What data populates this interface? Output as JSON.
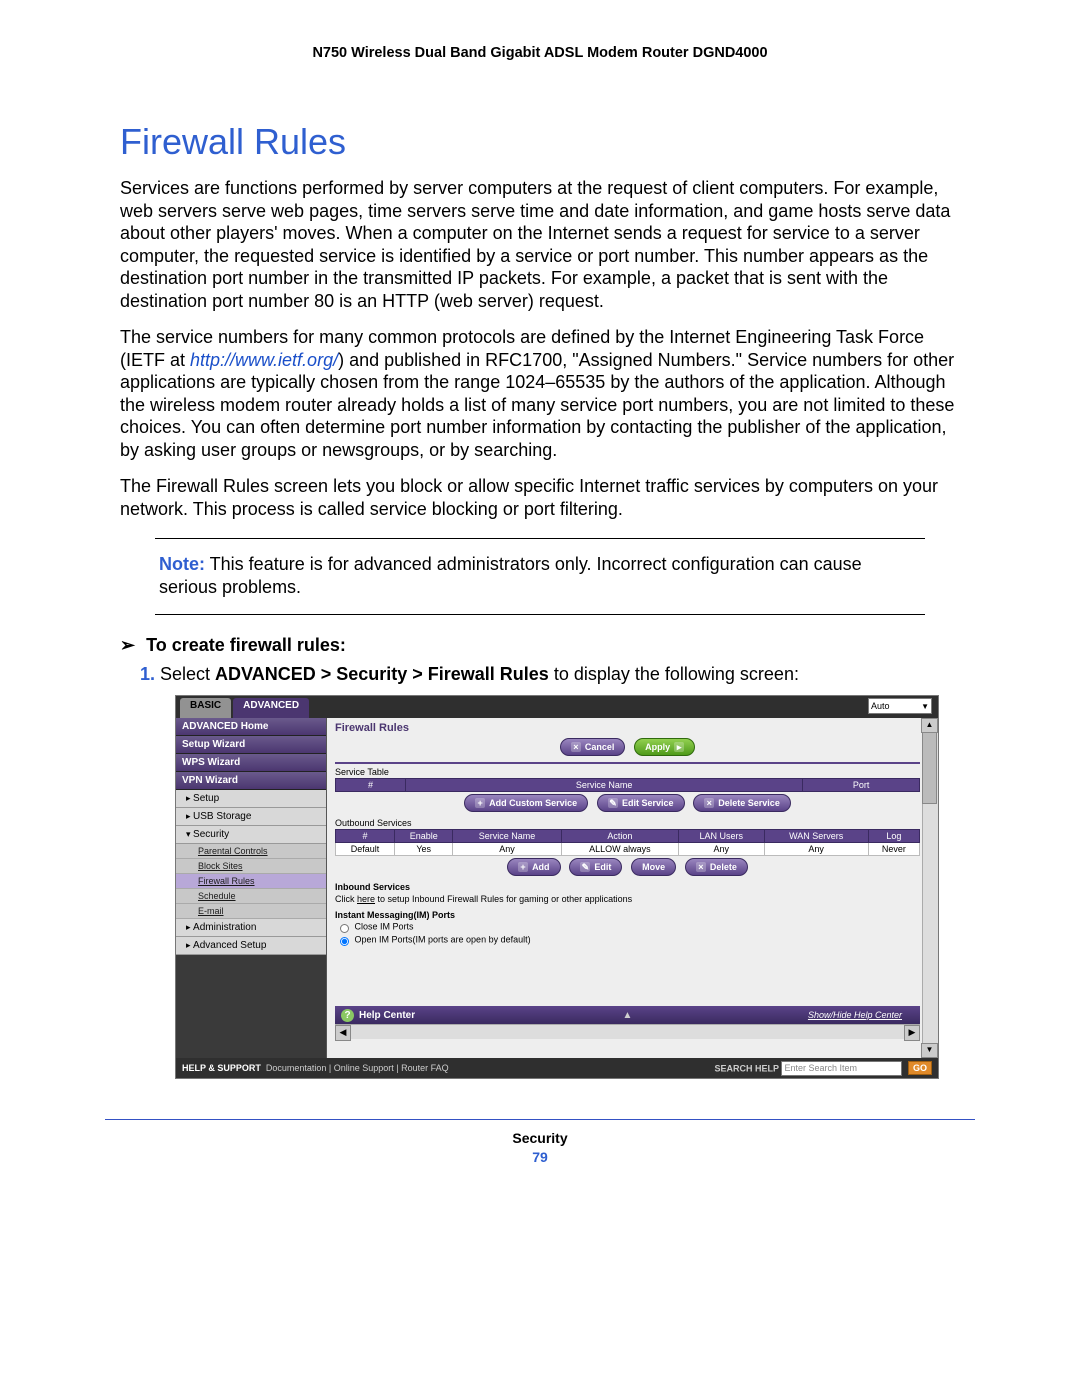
{
  "header": {
    "title": "N750 Wireless Dual Band Gigabit ADSL Modem Router DGND4000"
  },
  "heading": "Firewall Rules",
  "para1": "Services are functions performed by server computers at the request of client computers. For example, web servers serve web pages, time servers serve time and date information, and game hosts serve data about other players' moves. When a computer on the Internet sends a request for service to a server computer, the requested service is identified by a service or port number. This number appears as the destination port number in the transmitted IP packets. For example, a packet that is sent with the destination port number 80 is an HTTP (web server) request.",
  "para2a": "The service numbers for many common protocols are defined by the Internet Engineering Task Force (IETF at ",
  "para2_link": "http://www.ietf.org/",
  "para2b": ") and published in RFC1700, \"Assigned Numbers.\" Service numbers for other applications are typically chosen from the range 1024–65535 by the authors of the application. Although the wireless modem router already holds a list of many service port numbers, you are not limited to these choices. You can often determine port number information by contacting the publisher of the application, by asking user groups or newsgroups, or by searching.",
  "para3": "The Firewall Rules screen lets you block or allow specific Internet traffic services by computers on your network. This process is called service blocking or port filtering.",
  "note": {
    "label": "Note:",
    "text": " This feature is for advanced administrators only. Incorrect configuration can cause serious problems."
  },
  "task": {
    "arrow": "➢",
    "title": "To create firewall rules:",
    "step1a": "Select ",
    "step1b": "ADVANCED > Security > Firewall Rules",
    "step1c": " to display the following screen:"
  },
  "ui": {
    "tabs": {
      "basic": "BASIC",
      "advanced": "ADVANCED",
      "auto": "Auto"
    },
    "sidebar": {
      "adv_home": "ADVANCED Home",
      "setup_wizard": "Setup Wizard",
      "wps_wizard": "WPS Wizard",
      "vpn_wizard": "VPN Wizard",
      "setup": "Setup",
      "usb": "USB Storage",
      "security": "Security",
      "parental": "Parental Controls",
      "block_sites": "Block Sites",
      "firewall_rules": "Firewall Rules",
      "schedule": "Schedule",
      "email": "E-mail",
      "admin": "Administration",
      "adv_setup": "Advanced Setup"
    },
    "content": {
      "title": "Firewall Rules",
      "cancel": "Cancel",
      "apply": "Apply",
      "service_table": "Service Table",
      "col_num": "#",
      "col_service_name": "Service Name",
      "col_port": "Port",
      "add_custom": "Add Custom Service",
      "edit_service": "Edit Service",
      "delete_service": "Delete Service",
      "outbound": "Outbound Services",
      "col_enable": "Enable",
      "col_action": "Action",
      "col_lan": "LAN Users",
      "col_wan": "WAN Servers",
      "col_log": "Log",
      "row_default": "Default",
      "row_yes": "Yes",
      "row_any": "Any",
      "row_allow": "ALLOW always",
      "row_never": "Never",
      "btn_add": "Add",
      "btn_edit": "Edit",
      "btn_move": "Move",
      "btn_delete": "Delete",
      "inbound": "Inbound Services",
      "inbound_text_a": "Click ",
      "inbound_here": "here",
      "inbound_text_b": " to setup Inbound Firewall Rules for gaming or other applications",
      "im_title": "Instant Messaging(IM) Ports",
      "im_close": "Close IM Ports",
      "im_open": "Open IM Ports(IM ports are open by default)",
      "help_center": "Help Center",
      "showhide": "Show/Hide Help Center"
    },
    "footer": {
      "help_support": "HELP & SUPPORT",
      "doc": "Documentation",
      "online": "Online Support",
      "faq": "Router FAQ",
      "search_help": "SEARCH HELP",
      "search_placeholder": "Enter Search Item",
      "go": "GO"
    }
  },
  "page_footer": {
    "section": "Security",
    "page_num": "79"
  }
}
